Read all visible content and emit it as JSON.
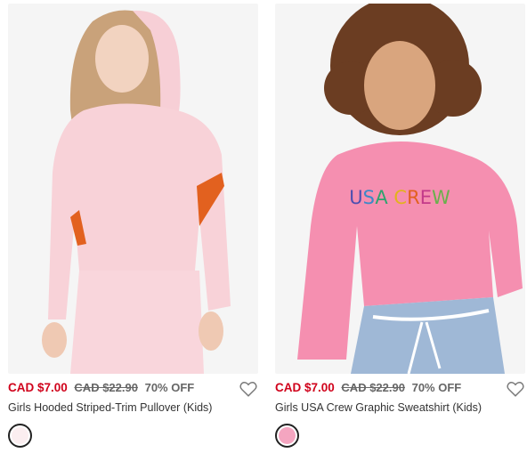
{
  "products": [
    {
      "price": "CAD $7.00",
      "original_price": "CAD $22.90",
      "discount": "70% OFF",
      "name": "Girls Hooded Striped-Trim Pullover (Kids)",
      "swatch_color": "#fbeef0",
      "image_icon": "product-photo",
      "wishlist_icon": "heart-outline-icon"
    },
    {
      "price": "CAD $7.00",
      "original_price": "CAD $22.90",
      "discount": "70% OFF",
      "name": "Girls USA Crew Graphic Sweatshirt (Kids)",
      "swatch_color": "#f4a5c0",
      "image_icon": "product-photo",
      "wishlist_icon": "heart-outline-icon",
      "graphic_text": "USA CREW"
    }
  ],
  "colors": {
    "sale_price": "#d0021b",
    "muted_text": "#666666",
    "text": "#333333"
  }
}
